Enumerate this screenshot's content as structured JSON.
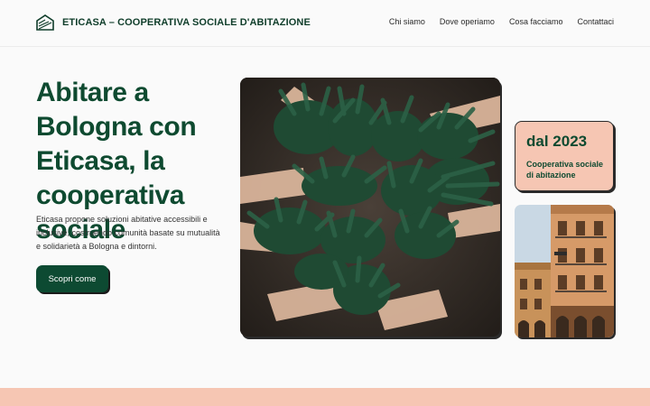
{
  "brand": {
    "name": "ETICASA – COOPERATIVA SOCIALE D'ABITAZIONE",
    "logo_icon": "house-icon"
  },
  "nav": {
    "items": [
      {
        "label": "Chi siamo"
      },
      {
        "label": "Dove operiamo"
      },
      {
        "label": "Cosa facciamo"
      },
      {
        "label": "Contattaci"
      }
    ]
  },
  "hero": {
    "title": "Abitare a Bologna con Eticasa, la cooperativa sociale",
    "description": "Eticasa propone soluzioni abitative accessibili e inclusive, costruendo comunità basate su mutualità e solidarietà a Bologna e dintorni.",
    "cta_label": "Scopri come"
  },
  "card": {
    "year": "dal 2023",
    "subtitle": "Cooperativa sociale di abitazione"
  },
  "colors": {
    "primary": "#0e4a30",
    "accent": "#f6c6b3",
    "background": "#fafafa"
  }
}
